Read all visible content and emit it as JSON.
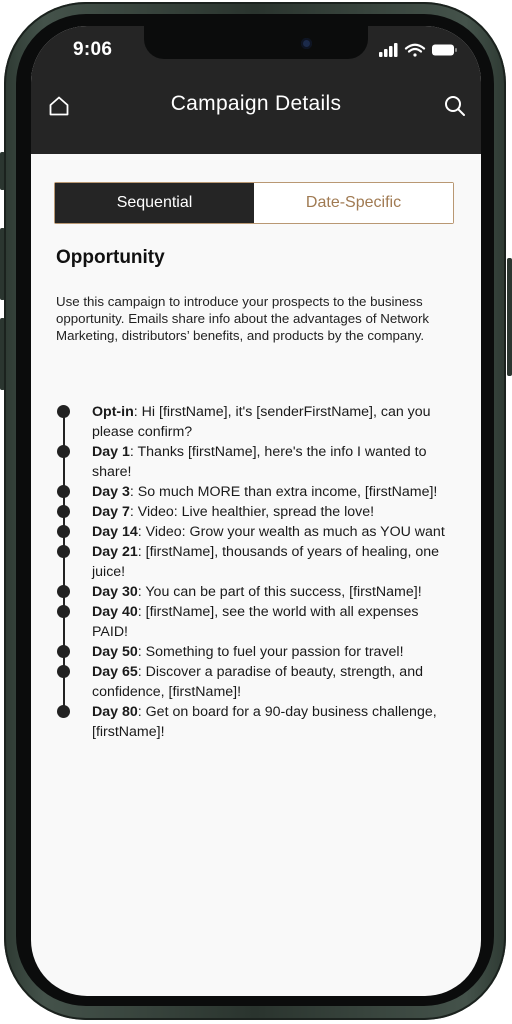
{
  "status_bar": {
    "time": "9:06",
    "icons": [
      "cellular-signal-icon",
      "wifi-icon",
      "battery-icon"
    ]
  },
  "header": {
    "title": "Campaign Details",
    "left_icon": "home-icon",
    "right_icon": "search-icon"
  },
  "tabs": [
    {
      "label": "Sequential",
      "active": true
    },
    {
      "label": "Date-Specific",
      "active": false
    }
  ],
  "campaign": {
    "name": "Opportunity",
    "description": "Use this campaign to introduce your prospects to the business opportunity. Emails share info about the advantages of Network Marketing, distributors’ benefits, and products by the company."
  },
  "schedule": [
    {
      "day": "Opt-in",
      "subject": "Hi [firstName], it's [senderFirstName], can you please confirm?"
    },
    {
      "day": "Day 1",
      "subject": "Thanks [firstName], here's the info I wanted to share!"
    },
    {
      "day": "Day 3",
      "subject": "So much MORE than extra income, [firstName]!"
    },
    {
      "day": "Day 7",
      "subject": "Video: Live healthier, spread the love!"
    },
    {
      "day": "Day 14",
      "subject": "Video: Grow your wealth as much as YOU want"
    },
    {
      "day": "Day 21",
      "subject": "[firstName], thousands of years of healing, one juice!"
    },
    {
      "day": "Day 30",
      "subject": "You can be part of this success, [firstName]!"
    },
    {
      "day": "Day 40",
      "subject": "[firstName], see the world with all expenses PAID!"
    },
    {
      "day": "Day 50",
      "subject": "Something to fuel your passion for travel!"
    },
    {
      "day": "Day 65",
      "subject": "Discover a paradise of beauty, strength, and confidence, [firstName]!"
    },
    {
      "day": "Day 80",
      "subject": "Get on board for a 90-day business challenge, [firstName]!"
    }
  ],
  "colors": {
    "header_bg": "#252525",
    "accent": "#b99873",
    "frame": "#3a4740"
  }
}
